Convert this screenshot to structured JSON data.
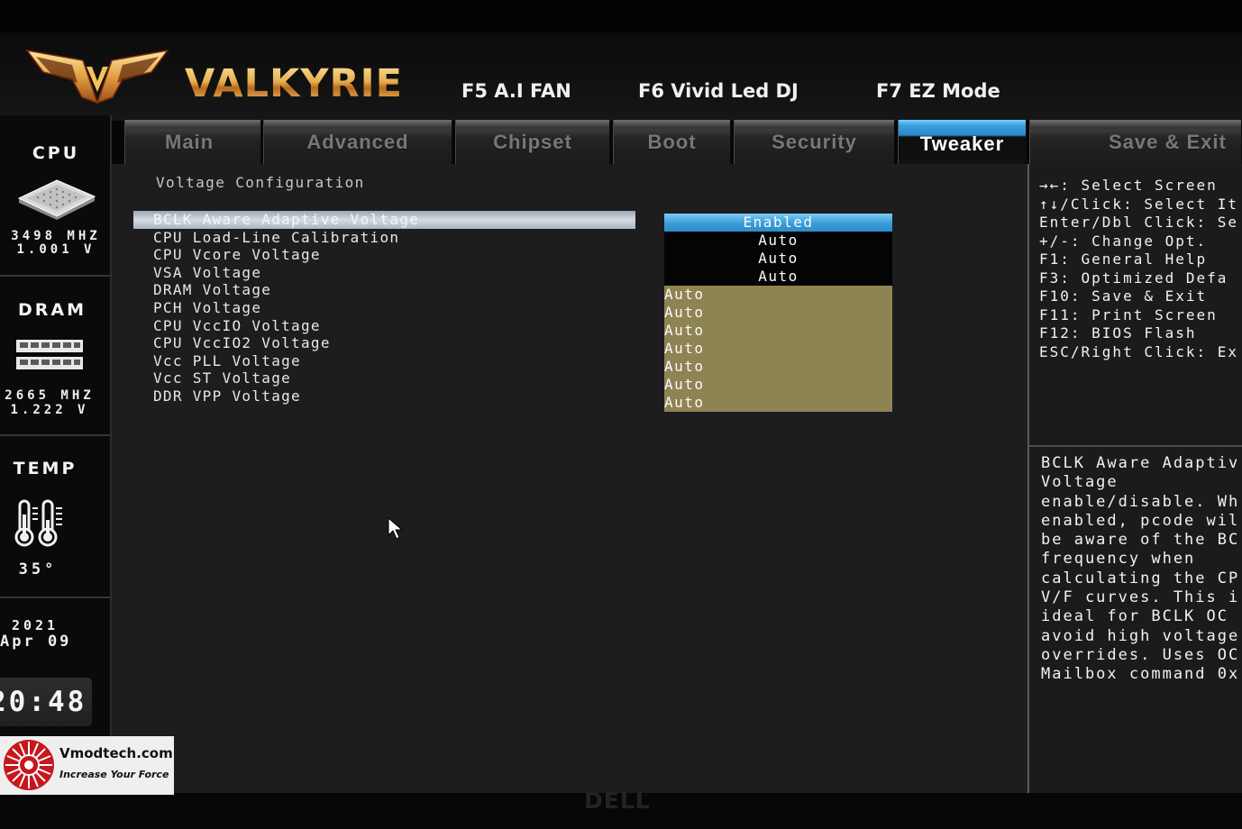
{
  "header": {
    "brand": "VALKYRIE",
    "hotkeys": [
      {
        "label": "F5 A.I FAN"
      },
      {
        "label": "F6 Vivid Led DJ"
      },
      {
        "label": "F7 EZ Mode"
      }
    ]
  },
  "tabs": [
    {
      "label": "Main",
      "active": false
    },
    {
      "label": "Advanced",
      "active": false
    },
    {
      "label": "Chipset",
      "active": false
    },
    {
      "label": "Boot",
      "active": false
    },
    {
      "label": "Security",
      "active": false
    },
    {
      "label": "Tweaker",
      "active": true
    },
    {
      "label": "Save & Exit",
      "active": false
    }
  ],
  "sidebar": {
    "cpu": {
      "label": "CPU",
      "frequency": "3498 MHZ",
      "voltage": "1.001 V",
      "icon": "cpu-chip-icon"
    },
    "dram": {
      "label": "DRAM",
      "frequency": "2665 MHZ",
      "voltage": "1.222 V",
      "icon": "memory-module-icon"
    },
    "temp": {
      "label": "TEMP",
      "value": "35°",
      "icon": "thermometer-icon"
    },
    "date": {
      "year": "2021",
      "day": "Apr 09"
    },
    "clock": "20:48"
  },
  "main": {
    "section_title": "Voltage Configuration",
    "items": [
      {
        "label": "BCLK Aware Adaptive Voltage",
        "value": "Enabled",
        "selected": true
      },
      {
        "label": "CPU Load-Line Calibration",
        "value": "Auto"
      },
      {
        "label": "CPU Vcore Voltage",
        "value": "Auto"
      },
      {
        "label": "VSA Voltage",
        "value": "Auto"
      },
      {
        "label": "DRAM Voltage",
        "value": "Auto"
      },
      {
        "label": "PCH Voltage",
        "value": "Auto"
      },
      {
        "label": "CPU VccIO Voltage",
        "value": "Auto"
      },
      {
        "label": "CPU VccIO2 Voltage",
        "value": "Auto"
      },
      {
        "label": "Vcc PLL Voltage",
        "value": "Auto"
      },
      {
        "label": "Vcc ST Voltage",
        "value": "Auto"
      },
      {
        "label": "DDR VPP Voltage",
        "value": "Auto"
      }
    ]
  },
  "help": {
    "keys": [
      "→←: Select Screen",
      "↑↓/Click: Select It",
      "Enter/Dbl Click: Se",
      "+/-: Change Opt.",
      "F1: General Help",
      "F3: Optimized Defa",
      "F10: Save & Exit",
      "F11: Print Screen",
      "F12: BIOS Flash",
      "ESC/Right Click: Ex"
    ],
    "description": [
      "BCLK Aware Adaptiv",
      "Voltage",
      "enable/disable. Wh",
      "enabled, pcode wil",
      "be aware of the BC",
      "frequency when",
      "calculating the CP",
      "V/F curves. This i",
      "ideal for BCLK OC",
      "avoid high voltage",
      "overrides. Uses OC",
      "Mailbox command 0x"
    ]
  },
  "watermark": {
    "site": "Vmodtech.com",
    "slogan": "Increase Your Force"
  },
  "bezel": {
    "brand": "DELL"
  },
  "colors": {
    "accent_blue": "#3a9cd8",
    "value_olive": "#8e8352",
    "brand_gold": "#e0a848",
    "selected_row": "#c4ccd4",
    "panel_background": "#1d1c1e"
  }
}
